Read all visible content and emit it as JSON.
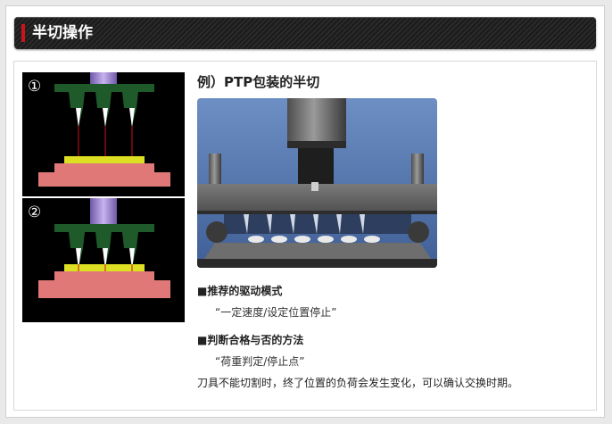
{
  "header": {
    "title": "半切操作"
  },
  "diagrams": [
    {
      "number": "①"
    },
    {
      "number": "②"
    }
  ],
  "subtitle": "例）PTP包装的半切",
  "recommended": {
    "label": "■推荐的驱动模式",
    "value": "“一定速度/设定位置停止”"
  },
  "judgement": {
    "label": "■判断合格与否的方法",
    "value": "“荷重判定/停止点”"
  },
  "note": "刀具不能切割时，终了位置的负荷会发生变化，可以确认交换时期。",
  "colors": {
    "accent": "#c9141b",
    "header_bg": "#222222",
    "blade_green": "#1f5a2a",
    "base_pink": "#e07878",
    "sheet_yellow": "#dde022",
    "rod_purple": "#9a7fc9"
  }
}
